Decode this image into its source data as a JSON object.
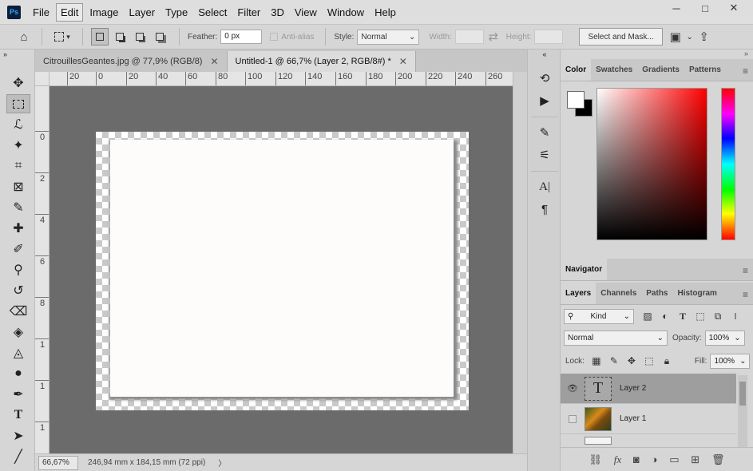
{
  "app": {
    "logo": "Ps"
  },
  "menu": [
    "File",
    "Edit",
    "Image",
    "Layer",
    "Type",
    "Select",
    "Filter",
    "3D",
    "View",
    "Window",
    "Help"
  ],
  "window_controls": {
    "minimize": "─",
    "restore": "□",
    "close": "✕"
  },
  "options": {
    "feather_label": "Feather:",
    "feather_value": "0 px",
    "anti_alias_label": "Anti-alias",
    "style_label": "Style:",
    "style_value": "Normal",
    "width_label": "Width:",
    "height_label": "Height:",
    "select_mask_label": "Select and Mask..."
  },
  "tabs": [
    {
      "label": "CitrouillesGeantes.jpg @ 77,9% (RGB/8)",
      "close": "✕"
    },
    {
      "label": "Untitled-1 @ 66,7% (Layer 2, RGB/8#) *",
      "close": "✕"
    }
  ],
  "ruler_h": [
    "20",
    "0",
    "20",
    "40",
    "60",
    "80",
    "100",
    "120",
    "140",
    "160",
    "180",
    "200",
    "220",
    "240",
    "260"
  ],
  "ruler_v": [
    "0",
    "2",
    "4",
    "6",
    "8",
    "1",
    "1",
    "1",
    "1"
  ],
  "status": {
    "zoom": "66,67%",
    "doc_size": "246,94 mm x 184,15 mm (72 ppi)",
    "arrow": "〉"
  },
  "color_panel": {
    "tabs": [
      "Color",
      "Swatches",
      "Gradients",
      "Patterns"
    ]
  },
  "navigator_panel": {
    "tabs": [
      "Navigator"
    ]
  },
  "layers_panel": {
    "tabs": [
      "Layers",
      "Channels",
      "Paths",
      "Histogram"
    ],
    "filter_value": "Kind",
    "blend_mode": "Normal",
    "opacity_label": "Opacity:",
    "opacity_value": "100%",
    "lock_label": "Lock:",
    "fill_label": "Fill:",
    "fill_value": "100%",
    "layers": [
      {
        "name": "Layer 2",
        "thumb": "T",
        "visible": true,
        "selected": true
      },
      {
        "name": "Layer 1",
        "thumb": "",
        "visible": false,
        "selected": false
      }
    ]
  },
  "icons": {
    "tools": [
      "move-icon",
      "marquee-icon",
      "lasso-icon",
      "magic-wand-icon",
      "crop-icon",
      "frame-icon",
      "eyedropper-icon",
      "healing-icon",
      "brush-icon",
      "stamp-icon",
      "history-brush-icon",
      "eraser-icon",
      "paint-bucket-icon",
      "blur-icon",
      "dodge-icon",
      "pen-icon",
      "type-icon",
      "path-select-icon",
      "line-icon"
    ]
  }
}
